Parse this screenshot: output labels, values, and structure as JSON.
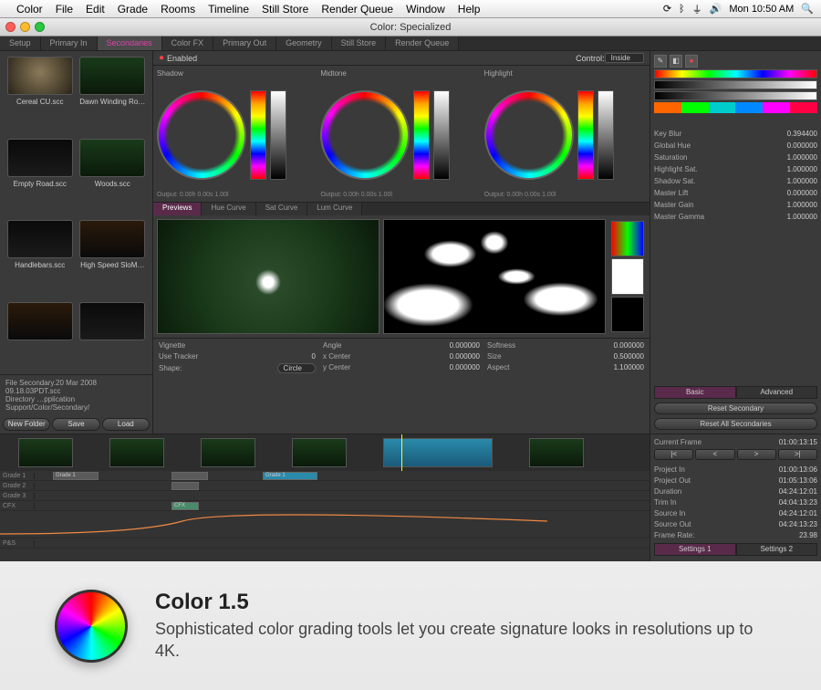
{
  "menubar": {
    "app": "Color",
    "items": [
      "File",
      "Edit",
      "Grade",
      "Rooms",
      "Timeline",
      "Still Store",
      "Render Queue",
      "Window",
      "Help"
    ],
    "clock": "Mon 10:50 AM"
  },
  "window_title": "Color: Specialized",
  "room_tabs": [
    "Setup",
    "Primary In",
    "Secondaries",
    "Color FX",
    "Primary Out",
    "Geometry",
    "Still Store",
    "Render Queue"
  ],
  "active_room": "Secondaries",
  "sidebar": {
    "clips": [
      {
        "name": "Cereal CU.scc"
      },
      {
        "name": "Dawn Winding Ro…"
      },
      {
        "name": "Empty Road.scc"
      },
      {
        "name": "Woods.scc"
      },
      {
        "name": "Handlebars.scc"
      },
      {
        "name": "High Speed SloM…"
      }
    ],
    "file": "Secondary.20 Mar 2008 09.18.03PDT.scc",
    "dir": "…pplication Support/Color/Secondary/",
    "buttons": {
      "new": "New Folder",
      "save": "Save",
      "load": "Load"
    }
  },
  "enabled_label": "Enabled",
  "control_label": "Control:",
  "control_value": "Inside",
  "wheels": {
    "shadow": {
      "label": "Shadow",
      "out": "Output: 0.00h 0.00s 1.00l"
    },
    "midtone": {
      "label": "Midtone",
      "out": "Output: 0.00h 0.00s 1.00l"
    },
    "highlight": {
      "label": "Highlight",
      "out": "Output: 0.00h 0.00s 1.00l"
    }
  },
  "preview_tabs": [
    "Previews",
    "Hue Curve",
    "Sat Curve",
    "Lum Curve"
  ],
  "active_preview": "Previews",
  "vignette": {
    "label": "Vignette",
    "use_tracker": {
      "label": "Use Tracker",
      "value": "0"
    },
    "shape": {
      "label": "Shape:",
      "value": "Circle"
    },
    "angle": {
      "label": "Angle",
      "value": "0.000000"
    },
    "xcenter": {
      "label": "x Center",
      "value": "0.000000"
    },
    "ycenter": {
      "label": "y Center",
      "value": "0.000000"
    },
    "softness": {
      "label": "Softness",
      "value": "0.000000"
    },
    "size": {
      "label": "Size",
      "value": "0.500000"
    },
    "aspect": {
      "label": "Aspect",
      "value": "1.100000"
    }
  },
  "right_params": {
    "key_blur": {
      "label": "Key Blur",
      "value": "0.394400"
    },
    "global_hue": {
      "label": "Global Hue",
      "value": "0.000000"
    },
    "saturation": {
      "label": "Saturation",
      "value": "1.000000"
    },
    "highlight_sat": {
      "label": "Highlight Sat.",
      "value": "1.000000"
    },
    "shadow_sat": {
      "label": "Shadow Sat.",
      "value": "1.000000"
    },
    "master_lift": {
      "label": "Master Lift",
      "value": "0.000000"
    },
    "master_gain": {
      "label": "Master Gain",
      "value": "1.000000"
    },
    "master_gamma": {
      "label": "Master Gamma",
      "value": "1.000000"
    }
  },
  "right_tabs": {
    "basic": "Basic",
    "advanced": "Advanced"
  },
  "reset": {
    "sec": "Reset Secondary",
    "all": "Reset All Secondaries"
  },
  "timeline": {
    "current_frame": {
      "label": "Current Frame",
      "value": "01:00:13:15"
    },
    "info": [
      {
        "label": "Project In",
        "value": "01:00:13:06"
      },
      {
        "label": "Project Out",
        "value": "01:05:13:06"
      },
      {
        "label": "Duration",
        "value": "04:24:12:01"
      },
      {
        "label": "Trim In",
        "value": "04:04:13:23"
      },
      {
        "label": "Source In",
        "value": "04:24:12:01"
      },
      {
        "label": "Source Out",
        "value": "04:24:13:23"
      }
    ],
    "frame_rate": {
      "label": "Frame Rate:",
      "value": "23.98"
    },
    "settings_tabs": [
      "Settings 1",
      "Settings 2"
    ],
    "tracks": [
      "Grade 1",
      "Grade 2",
      "Grade 3",
      "CFX",
      "",
      "P&S"
    ]
  },
  "promo": {
    "title": "Color 1.5",
    "desc": "Sophisticated color grading tools let you create signature looks in resolutions up to 4K."
  }
}
